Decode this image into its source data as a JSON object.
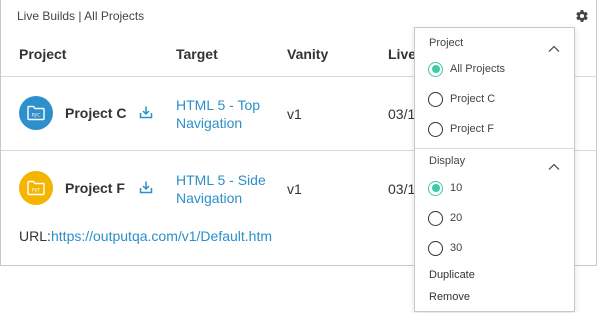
{
  "panel": {
    "title": "Live Builds | All Projects"
  },
  "table": {
    "columns": [
      "Project",
      "Target",
      "Vanity",
      "Live"
    ],
    "rows": [
      {
        "icon_text": "PJ/C",
        "icon_color": "#2d8fcc",
        "project": "Project C",
        "target_line1": "HTML 5 - Top",
        "target_line2": "Navigation",
        "vanity": "v1",
        "live": "03/1"
      },
      {
        "icon_text": "PJ/F",
        "icon_color": "#f5b400",
        "project": "Project F",
        "target_line1": "HTML 5 - Side",
        "target_line2": "Navigation",
        "vanity": "v1",
        "live": "03/1"
      }
    ],
    "url_label": "URL:",
    "url_value": "https://outputqa.com/v1/Default.htm"
  },
  "menu": {
    "project_section": {
      "title": "Project",
      "options": [
        {
          "label": "All Projects",
          "selected": true
        },
        {
          "label": "Project C",
          "selected": false
        },
        {
          "label": "Project F",
          "selected": false
        }
      ]
    },
    "display_section": {
      "title": "Display",
      "options": [
        {
          "label": "10",
          "selected": true
        },
        {
          "label": "20",
          "selected": false
        },
        {
          "label": "30",
          "selected": false
        }
      ]
    },
    "actions": [
      "Duplicate",
      "Remove"
    ]
  },
  "colors": {
    "accent_teal": "#3ec9a7",
    "link_blue": "#2c8fc9"
  }
}
